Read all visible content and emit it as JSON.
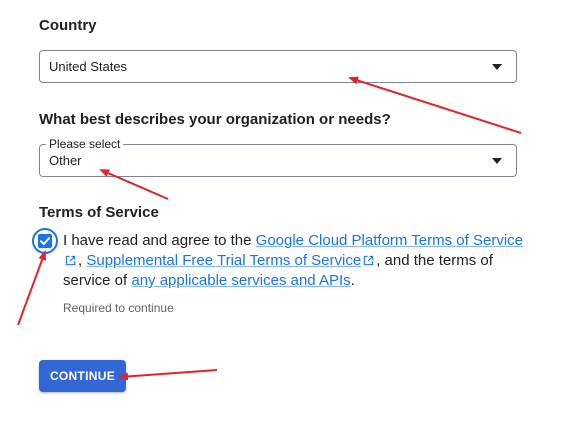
{
  "country": {
    "heading": "Country",
    "selected_value": "United States"
  },
  "organization": {
    "heading": "What best describes your organization or needs?",
    "field_label": "Please select",
    "selected_value": "Other"
  },
  "terms": {
    "heading": "Terms of Service",
    "checked": true,
    "text_before": "I have read and agree to the ",
    "link_gcp_terms": "Google Cloud Platform Terms of Service",
    "comma": ", ",
    "link_supplemental": "Supplemental Free Trial Terms of Service",
    "text_middle": ", and the terms of service of ",
    "link_services": "any applicable services and APIs",
    "period": ".",
    "helper": "Required to continue"
  },
  "actions": {
    "continue_label": "CONTINUE"
  },
  "colors": {
    "accent": "#1a73e8",
    "button": "#3367d6",
    "annotation_arrow": "#e0242b"
  },
  "icons": [
    "dropdown-arrow-icon",
    "checkmark-icon",
    "external-link-icon"
  ]
}
